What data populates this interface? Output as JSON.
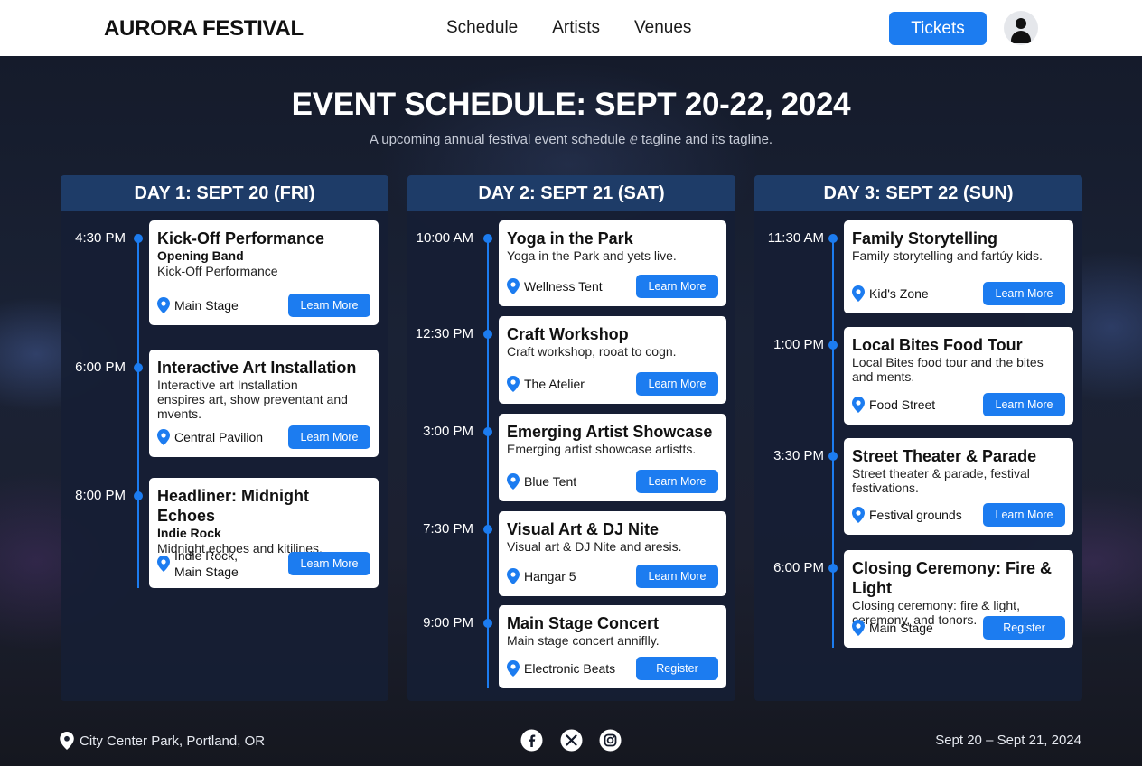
{
  "nav": {
    "brand": "AURORA FESTIVAL",
    "links": [
      "Schedule",
      "Artists",
      "Venues"
    ],
    "tickets_label": "Tickets"
  },
  "hero": {
    "title": "EVENT SCHEDULE: SEPT 20-22, 2024",
    "subtitle": "A upcoming annual festival event schedule ⅇ tagline and its  tagline."
  },
  "days": [
    {
      "header": "DAY 1: SEPT 20 (FRI)",
      "events": [
        {
          "time": "4:30 PM",
          "title": "Kick-Off Performance",
          "subtitle": "Opening Band",
          "desc": [
            "Kick-Off Performance"
          ],
          "location": [
            "Main Stage"
          ],
          "button": "Learn More"
        },
        {
          "time": "6:00 PM",
          "title": "Interactive Art Installation",
          "subtitle": "",
          "desc": [
            "Interactive art Installation",
            "enspires art, show preventant and",
            "mvents."
          ],
          "location": [
            "Central Pavilion"
          ],
          "button": "Learn More"
        },
        {
          "time": "8:00 PM",
          "title": "Headliner: Midnight Echoes",
          "subtitle": "Indie Rock",
          "desc": [
            "Midnight echoes and kitilines."
          ],
          "location": [
            "Indie Rock,",
            "Main Stage"
          ],
          "button": "Learn More"
        }
      ]
    },
    {
      "header": "DAY 2: SEPT 21 (SAT)",
      "events": [
        {
          "time": "10:00 AM",
          "title": "Yoga in the Park",
          "subtitle": "",
          "desc": [
            "Yoga in the Park and yets live."
          ],
          "location": [
            "Wellness Tent"
          ],
          "button": "Learn More"
        },
        {
          "time": "12:30 PM",
          "title": "Craft Workshop",
          "subtitle": "",
          "desc": [
            "Craft workshop, rooat to cogn."
          ],
          "location": [
            "The Atelier"
          ],
          "button": "Learn More"
        },
        {
          "time": "3:00 PM",
          "title": "Emerging Artist Showcase",
          "subtitle": "",
          "desc": [
            "Emerging artist showcase artistts."
          ],
          "location": [
            "Blue Tent"
          ],
          "button": "Learn More"
        },
        {
          "time": "7:30 PM",
          "title": "Visual Art & DJ Nite",
          "subtitle": "",
          "desc": [
            "Visual art & DJ Nite and aresis."
          ],
          "location": [
            "Hangar 5"
          ],
          "button": "Learn More"
        },
        {
          "time": "9:00 PM",
          "title": "Main Stage Concert",
          "subtitle": "",
          "desc": [
            "Main stage concert anniflly."
          ],
          "location": [
            "Electronic Beats"
          ],
          "button": "Register"
        }
      ]
    },
    {
      "header": "DAY 3: SEPT 22 (SUN)",
      "events": [
        {
          "time": "11:30 AM",
          "title": "Family Storytelling",
          "subtitle": "",
          "desc": [
            "Family storytelling and fartúy kids."
          ],
          "location": [
            "Kid's Zone"
          ],
          "button": "Learn More"
        },
        {
          "time": "1:00 PM",
          "title": "Local Bites Food Tour",
          "subtitle": "",
          "desc": [
            "Local Bites food tour and the bites",
            "and ments."
          ],
          "location": [
            "Food Street"
          ],
          "button": "Learn More"
        },
        {
          "time": "3:30 PM",
          "title": "Street Theater & Parade",
          "subtitle": "",
          "desc": [
            "Street theater & parade, festival",
            "festivations."
          ],
          "location": [
            "Festival grounds"
          ],
          "button": "Learn More"
        },
        {
          "time": "6:00 PM",
          "title": "Closing Ceremony: Fire & Light",
          "subtitle": "",
          "desc": [
            "Closing ceremony: fire & light,",
            "ceremony, and tonors."
          ],
          "location": [
            "Main Stage"
          ],
          "button": "Register"
        }
      ]
    }
  ],
  "footer": {
    "location": "City Center Park, Portland, OR",
    "dates": "Sept 20 – Sept 21, 2024",
    "social_icons": [
      "facebook-icon",
      "x-icon",
      "instagram-icon"
    ]
  },
  "colors": {
    "accent": "#1c7cf0",
    "day_header": "#1e3c68",
    "panel": "#161e34"
  }
}
